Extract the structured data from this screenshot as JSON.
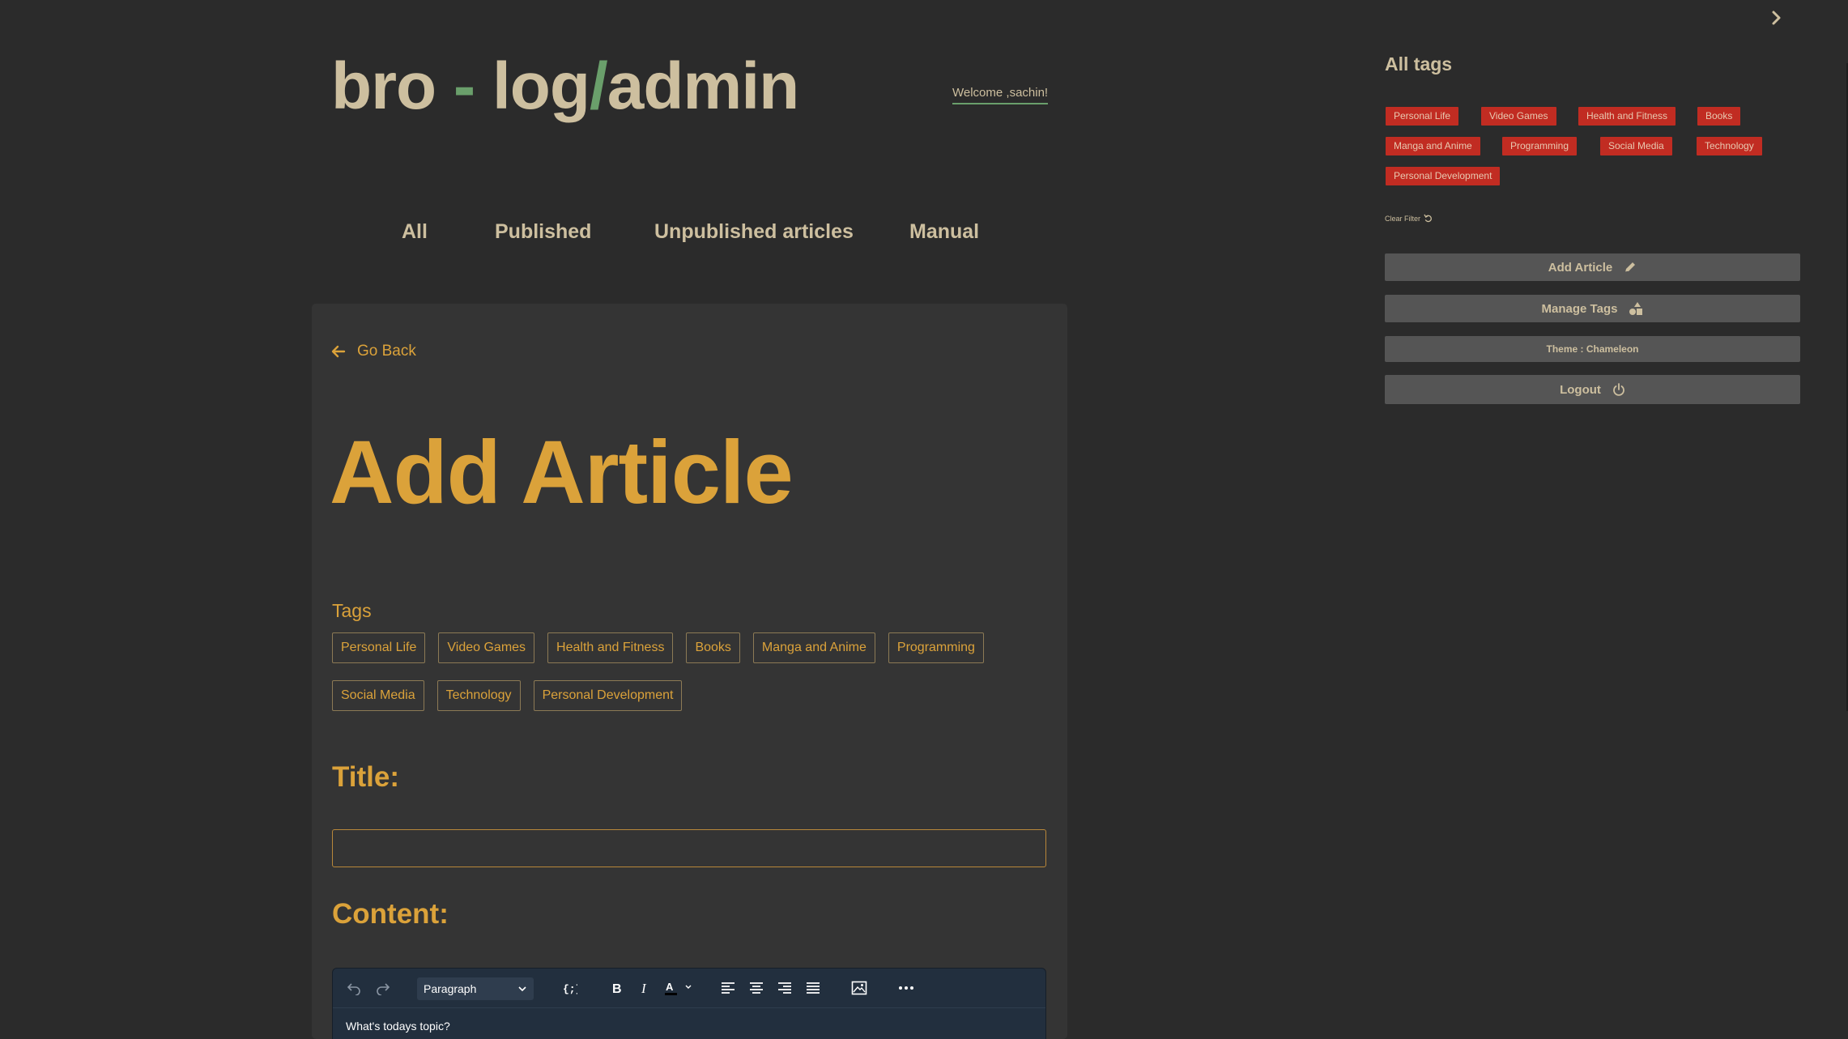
{
  "header": {
    "logo_part1": "bro",
    "logo_dash": " - ",
    "logo_part2": "log",
    "logo_slash": "/",
    "logo_part3": "admin",
    "welcome": "Welcome ,sachin!"
  },
  "nav": {
    "items": [
      "All",
      "Published",
      "Unpublished articles",
      "Manual"
    ]
  },
  "main": {
    "go_back": "Go Back",
    "title": "Add Article",
    "tags_label": "Tags",
    "tags": [
      "Personal Life",
      "Video Games",
      "Health and Fitness",
      "Books",
      "Manga and Anime",
      "Programming",
      "Social Media",
      "Technology",
      "Personal Development"
    ],
    "title_label": "Title:",
    "title_value": "",
    "content_label": "Content:",
    "editor": {
      "block_format": "Paragraph",
      "placeholder": "What's todays topic?"
    }
  },
  "sidebar": {
    "title": "All tags",
    "tags": [
      "Personal Life",
      "Video Games",
      "Health and Fitness",
      "Books",
      "Manga and Anime",
      "Programming",
      "Social Media",
      "Technology",
      "Personal Development"
    ],
    "clear_filter": "Clear Filter",
    "add_article": "Add Article",
    "manage_tags": "Manage Tags",
    "theme": "Theme : Chameleon",
    "logout": "Logout"
  },
  "colors": {
    "background": "#2b2b2b",
    "card": "#343434",
    "accent_orange": "#dba23a",
    "accent_green": "#6a9f6b",
    "beige_text": "#cdbf9f",
    "tag_red": "#c12c22",
    "editor_bg": "#222f3e",
    "sidebar_button": "#555555"
  },
  "icons": [
    "chevron-right-icon",
    "arrow-left-icon",
    "pencil-icon",
    "shapes-icon",
    "power-icon",
    "refresh-icon",
    "undo-icon",
    "redo-icon",
    "code-icon",
    "bold-icon",
    "italic-icon",
    "text-color-icon",
    "align-left-icon",
    "align-center-icon",
    "align-right-icon",
    "align-justify-icon",
    "image-icon",
    "more-icon"
  ]
}
